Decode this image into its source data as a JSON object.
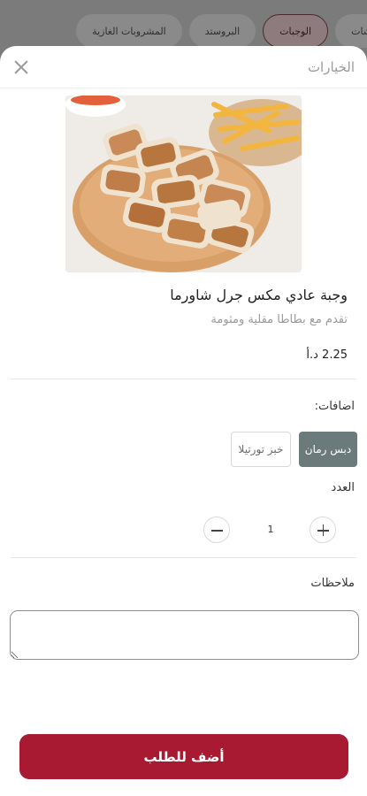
{
  "categories": [
    {
      "label": "بتشات",
      "active": false
    },
    {
      "label": "الوجبات",
      "active": true
    },
    {
      "label": "البروستد",
      "active": false
    },
    {
      "label": "المشروبات الغازية",
      "active": false
    }
  ],
  "sheet": {
    "title": "الخيارات",
    "close_icon": "close-icon"
  },
  "product": {
    "name": "وجبة عادي مكس جرل شاورما",
    "description": "تقدم مع بطاطا مقلية ومثومة",
    "price": "2.25 د.أ"
  },
  "addons": {
    "label": "اضافات:",
    "options": [
      {
        "label": "دبس رمان",
        "selected": true
      },
      {
        "label": "خبز تورتيلا",
        "selected": false
      }
    ]
  },
  "quantity": {
    "label": "العدد",
    "value": "1"
  },
  "notes": {
    "label": "ملاحظات",
    "value": ""
  },
  "add_button": {
    "label": "أضف للطلب"
  },
  "colors": {
    "accent": "#a81a31",
    "addon_selected": "#6b7a7b"
  }
}
